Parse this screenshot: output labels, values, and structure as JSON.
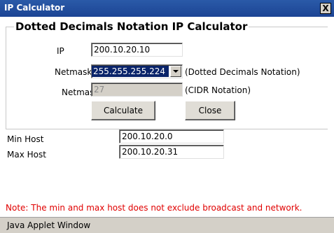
{
  "window": {
    "title": "IP Calculator",
    "close_glyph": "X"
  },
  "calculator": {
    "heading": "Dotted Decimals Notation IP Calculator",
    "ip_label": "IP",
    "ip_value": "200.10.20.10",
    "netmask_label": "Netmask",
    "netmask_value": "255.255.255.224",
    "netmask_note": "(Dotted Decimals Notation)",
    "cidr_label": "Netmask",
    "cidr_value": "27",
    "cidr_note": "(CIDR Notation)",
    "calculate_label": "Calculate",
    "close_label": "Close"
  },
  "results": {
    "min_host_label": "Min Host",
    "min_host_value": "200.10.20.0",
    "max_host_label": "Max Host",
    "max_host_value": "200.10.20.31"
  },
  "note": "Note: The min and max host does not exclude broadcast and network.",
  "status": "Java Applet Window",
  "colors": {
    "title_bar": "#1c4494",
    "selection": "#0a246a",
    "note_text": "#e00000",
    "status_bar": "#d4d0c8"
  }
}
